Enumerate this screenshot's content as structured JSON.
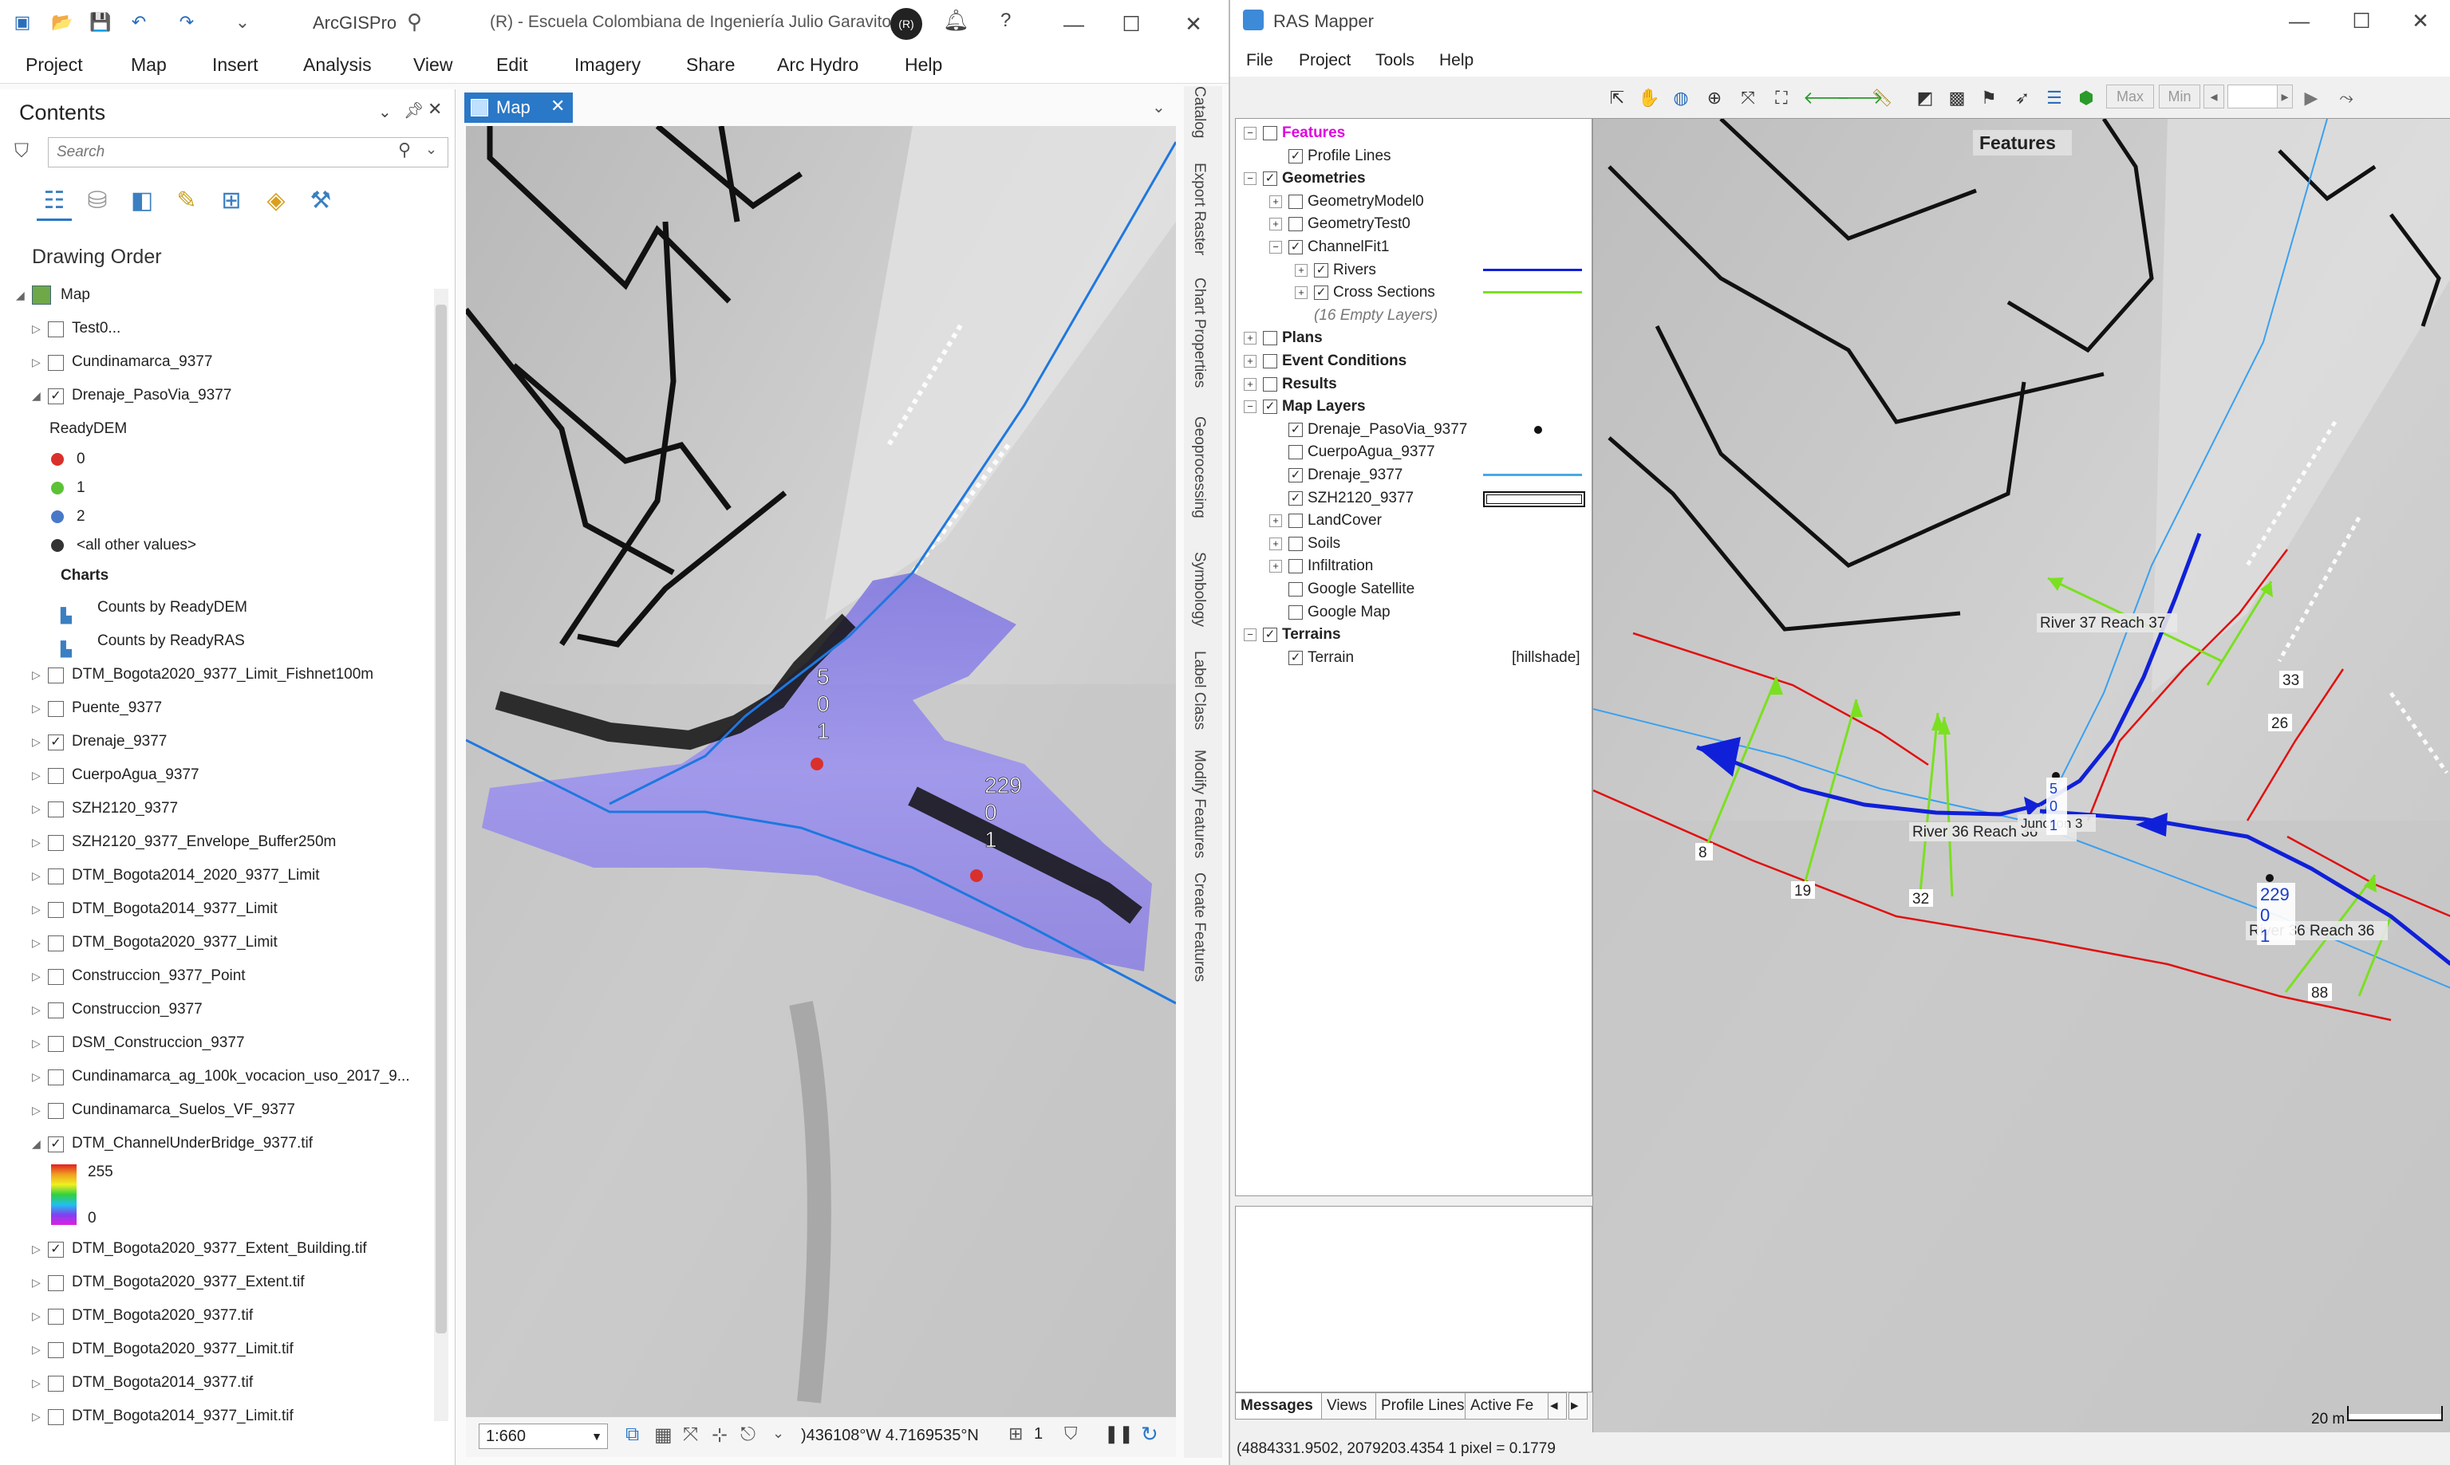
{
  "arcgis": {
    "app_name": "ArcGISPro",
    "document_title": "(R) - Escuela Colombiana de Ingeniería Julio Garavito",
    "user_initials": "(R)",
    "menu": [
      "Project",
      "Map",
      "Insert",
      "Analysis",
      "View",
      "Edit",
      "Imagery",
      "Share",
      "Arc Hydro",
      "Help"
    ],
    "contents": {
      "title": "Contents",
      "search_placeholder": "Search",
      "section_title": "Drawing Order",
      "root_label": "Map",
      "layers": [
        {
          "label": "Test0...",
          "checked": false,
          "expanded": false
        },
        {
          "label": "Cundinamarca_9377",
          "checked": false,
          "expanded": false
        },
        {
          "label": "Drenaje_PasoVia_9377",
          "checked": true,
          "expanded": true
        }
      ],
      "legend_title": "ReadyDEM",
      "legend_items": [
        {
          "label": "0",
          "color": "#d9302c"
        },
        {
          "label": "1",
          "color": "#5bc236"
        },
        {
          "label": "2",
          "color": "#4a78c8"
        },
        {
          "label": "<all other values>",
          "color": "#333333"
        }
      ],
      "charts_title": "Charts",
      "charts": [
        "Counts by ReadyDEM",
        "Counts by ReadyRAS"
      ],
      "more_layers": [
        {
          "label": "DTM_Bogota2020_9377_Limit_Fishnet100m",
          "checked": false
        },
        {
          "label": "Puente_9377",
          "checked": false
        },
        {
          "label": "Drenaje_9377",
          "checked": true
        },
        {
          "label": "CuerpoAgua_9377",
          "checked": false
        },
        {
          "label": "SZH2120_9377",
          "checked": false
        },
        {
          "label": "SZH2120_9377_Envelope_Buffer250m",
          "checked": false
        },
        {
          "label": "DTM_Bogota2014_2020_9377_Limit",
          "checked": false
        },
        {
          "label": "DTM_Bogota2014_9377_Limit",
          "checked": false
        },
        {
          "label": "DTM_Bogota2020_9377_Limit",
          "checked": false
        },
        {
          "label": "Construccion_9377_Point",
          "checked": false
        },
        {
          "label": "Construccion_9377",
          "checked": false
        },
        {
          "label": "DSM_Construccion_9377",
          "checked": false
        },
        {
          "label": "Cundinamarca_ag_100k_vocacion_uso_2017_9...",
          "checked": false
        },
        {
          "label": "Cundinamarca_Suelos_VF_9377",
          "checked": false
        },
        {
          "label": "DTM_ChannelUnderBridge_9377.tif",
          "checked": true
        }
      ],
      "ramp_high": "255",
      "ramp_low": "0",
      "tail_layers": [
        {
          "label": "DTM_Bogota2020_9377_Extent_Building.tif",
          "checked": true
        },
        {
          "label": "DTM_Bogota2020_9377_Extent.tif",
          "checked": false
        },
        {
          "label": "DTM_Bogota2020_9377.tif",
          "checked": false
        },
        {
          "label": "DTM_Bogota2020_9377_Limit.tif",
          "checked": false
        },
        {
          "label": "DTM_Bogota2014_9377.tif",
          "checked": false
        },
        {
          "label": "DTM_Bogota2014_9377_Limit.tif",
          "checked": false
        }
      ]
    },
    "map_tab": "Map",
    "map_labels": {
      "a": [
        "5",
        "0",
        "1"
      ],
      "b": [
        "229",
        "0",
        "1"
      ]
    },
    "scale": "1:660",
    "coordinates": ")436108°W 4.7169535°N",
    "selection_count": "1",
    "side_tabs": [
      "Catalog",
      "Export Raster",
      "Chart Properties",
      "Geoprocessing",
      "Symbology",
      "Label Class",
      "Modify Features",
      "Create Features"
    ]
  },
  "ras": {
    "app_name": "RAS Mapper",
    "menu": [
      "File",
      "Project",
      "Tools",
      "Help"
    ],
    "toolbar_buttons": {
      "max": "Max",
      "min": "Min"
    },
    "tree": [
      {
        "label": "Features",
        "indent": 0,
        "checked": false,
        "bold": true,
        "color": "#e000e0",
        "exp": "−"
      },
      {
        "label": "Profile Lines",
        "indent": 1,
        "checked": true,
        "exp": ""
      },
      {
        "label": "Geometries",
        "indent": 0,
        "checked": true,
        "bold": true,
        "exp": "−"
      },
      {
        "label": "GeometryModel0",
        "indent": 1,
        "checked": false,
        "exp": "+"
      },
      {
        "label": "GeometryTest0",
        "indent": 1,
        "checked": false,
        "exp": "+"
      },
      {
        "label": "ChannelFit1",
        "indent": 1,
        "checked": true,
        "exp": "−"
      },
      {
        "label": "Rivers",
        "indent": 2,
        "checked": true,
        "exp": "+",
        "swatch": "#1020d8"
      },
      {
        "label": "Cross Sections",
        "indent": 2,
        "checked": true,
        "exp": "+",
        "swatch": "#7be020"
      },
      {
        "label": "(16 Empty Layers)",
        "indent": 2,
        "italic": true
      },
      {
        "label": "Plans",
        "indent": 0,
        "checked": false,
        "bold": true,
        "exp": "+"
      },
      {
        "label": "Event Conditions",
        "indent": 0,
        "checked": false,
        "bold": true,
        "exp": "+"
      },
      {
        "label": "Results",
        "indent": 0,
        "checked": false,
        "bold": true,
        "exp": "+"
      },
      {
        "label": "Map Layers",
        "indent": 0,
        "checked": true,
        "bold": true,
        "exp": "−"
      },
      {
        "label": "Drenaje_PasoVia_9377",
        "indent": 1,
        "checked": true,
        "exp": "",
        "swatch": "dot"
      },
      {
        "label": "CuerpoAgua_9377",
        "indent": 1,
        "checked": false,
        "exp": ""
      },
      {
        "label": "Drenaje_9377",
        "indent": 1,
        "checked": true,
        "exp": "",
        "swatch": "#4aa8e8"
      },
      {
        "label": "SZH2120_9377",
        "indent": 1,
        "checked": true,
        "exp": "",
        "swatch": "box"
      },
      {
        "label": "LandCover",
        "indent": 1,
        "checked": false,
        "exp": "+"
      },
      {
        "label": "Soils",
        "indent": 1,
        "checked": false,
        "exp": "+"
      },
      {
        "label": "Infiltration",
        "indent": 1,
        "checked": false,
        "exp": "+"
      },
      {
        "label": "Google Satellite",
        "indent": 1,
        "checked": false,
        "exp": ""
      },
      {
        "label": "Google Map",
        "indent": 1,
        "checked": false,
        "exp": ""
      },
      {
        "label": "Terrains",
        "indent": 0,
        "checked": true,
        "bold": true,
        "exp": "−"
      },
      {
        "label": "Terrain",
        "indent": 1,
        "checked": true,
        "exp": "",
        "note": "[hillshade]"
      }
    ],
    "message_tabs": [
      "Messages",
      "Views",
      "Profile Lines",
      "Active Fe"
    ],
    "map_title": "Features",
    "map_labels": {
      "river37": "River 37  Reach 37",
      "river36a": "River 36  Reach 36",
      "river36b": "River 36  Reach 36",
      "junction": "Junction 3",
      "xs_8": "8",
      "xs_19": "19",
      "xs_32": "32",
      "xs_26": "26",
      "xs_33": "33",
      "xs_88": "88",
      "pt_229": "229",
      "pt_0a": "0",
      "pt_1a": "1",
      "pt_5": "5",
      "pt_0b": "0",
      "pt_1b": "1"
    },
    "scale_bar": "20 m",
    "status": "(4884331.9502, 2079203.4354  1 pixel = 0.1779"
  }
}
